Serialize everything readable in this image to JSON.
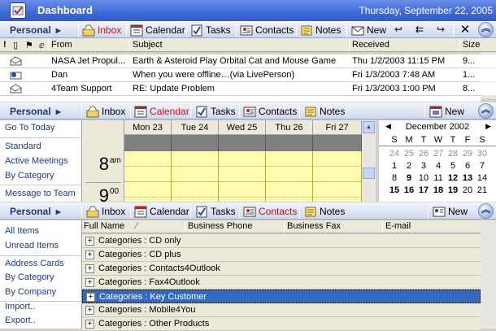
{
  "title_bar": {
    "title": "Dashboard",
    "date": "Thursday, September 22, 2005"
  },
  "inbox_toolbar": {
    "personal": "Personal",
    "buttons": [
      {
        "label": "Inbox",
        "icon": "inbox-icon",
        "active": true
      },
      {
        "label": "Calendar",
        "icon": "calendar-icon",
        "active": false
      },
      {
        "label": "Tasks",
        "icon": "tasks-icon",
        "active": false
      },
      {
        "label": "Contacts",
        "icon": "contacts-icon",
        "active": false
      },
      {
        "label": "Notes",
        "icon": "notes-icon",
        "active": false
      }
    ],
    "new_label": "New",
    "extra_icons": [
      "reply-icon",
      "reply-all-icon",
      "forward-icon",
      "delete-icon",
      "collapse-icon"
    ]
  },
  "inbox_columns": {
    "importance": "!",
    "from": "From",
    "subject": "Subject",
    "received": "Received",
    "size": "Size"
  },
  "inbox_rows": [
    {
      "from": "NASA Jet Propul...",
      "subject": "Earth & Asteroid Play Orbital Cat and Mouse Game",
      "received": "Thu 1/2/2003 11:15 PM",
      "size": "9..."
    },
    {
      "from": "Dan",
      "subject": "When you were offline…(via LivePerson)",
      "received": "Fri 1/3/2003 7:48 AM",
      "size": "1..."
    },
    {
      "from": "4Team Support",
      "subject": "RE: Update Problem",
      "received": "Fri 1/3/2003 1:00 PM",
      "size": "8..."
    }
  ],
  "calendar_toolbar": {
    "personal": "Personal",
    "buttons": [
      {
        "label": "Inbox",
        "active": false
      },
      {
        "label": "Calendar",
        "active": true
      },
      {
        "label": "Tasks",
        "active": false
      },
      {
        "label": "Contacts",
        "active": false
      },
      {
        "label": "Notes",
        "active": false
      }
    ],
    "new_label": "New"
  },
  "calendar_nav": [
    {
      "label": "Go To Today"
    },
    {
      "label": "Standard"
    },
    {
      "label": "Active Meetings"
    },
    {
      "label": "By Category"
    },
    {
      "label": "Message to Team"
    }
  ],
  "calendar_days": [
    "Mon 23",
    "Tue 24",
    "Wed 25",
    "Thu 26",
    "Fri 27"
  ],
  "calendar_times": [
    {
      "hour": "8",
      "suffix": "am"
    },
    {
      "hour": "9",
      "suffix": "00"
    }
  ],
  "mini_calendar": {
    "month": "December 2002",
    "dow": [
      "S",
      "M",
      "T",
      "W",
      "T",
      "F",
      "S"
    ],
    "weeks": [
      [
        {
          "d": "24",
          "g": 1
        },
        {
          "d": "25",
          "g": 1
        },
        {
          "d": "26",
          "g": 1
        },
        {
          "d": "27",
          "g": 1
        },
        {
          "d": "28",
          "g": 1
        },
        {
          "d": "29",
          "g": 1
        },
        {
          "d": "30",
          "g": 1
        }
      ],
      [
        {
          "d": "1"
        },
        {
          "d": "2"
        },
        {
          "d": "3"
        },
        {
          "d": "4"
        },
        {
          "d": "5"
        },
        {
          "d": "6"
        },
        {
          "d": "7"
        }
      ],
      [
        {
          "d": "8"
        },
        {
          "d": "9",
          "b": 1
        },
        {
          "d": "10"
        },
        {
          "d": "11"
        },
        {
          "d": "12",
          "b": 1
        },
        {
          "d": "13",
          "b": 1
        },
        {
          "d": "14"
        }
      ],
      [
        {
          "d": "15",
          "b": 1
        },
        {
          "d": "16",
          "b": 1
        },
        {
          "d": "17",
          "b": 1
        },
        {
          "d": "18",
          "b": 1
        },
        {
          "d": "19",
          "b": 1
        },
        {
          "d": "20"
        },
        {
          "d": "21"
        }
      ]
    ]
  },
  "contacts_toolbar": {
    "personal": "Personal",
    "buttons": [
      {
        "label": "Inbox",
        "active": false
      },
      {
        "label": "Calendar",
        "active": false
      },
      {
        "label": "Tasks",
        "active": false
      },
      {
        "label": "Contacts",
        "active": true
      },
      {
        "label": "Notes",
        "active": false
      }
    ],
    "new_label": "New"
  },
  "contacts_nav": [
    {
      "label": "All Items"
    },
    {
      "label": "Unread Items"
    },
    {
      "label": "Address Cards"
    },
    {
      "label": "By Category"
    },
    {
      "label": "By Company"
    },
    {
      "label": "Import.."
    },
    {
      "label": "Export.."
    }
  ],
  "contacts_columns": {
    "full_name": "Full Name",
    "business_phone": "Business Phone",
    "business_fax": "Business Fax",
    "email": "E-mail"
  },
  "contact_groups": [
    {
      "label": "Categories : CD only",
      "selected": false
    },
    {
      "label": "Categories : CD plus",
      "selected": false
    },
    {
      "label": "Categories : Contacts4Outlook",
      "selected": false
    },
    {
      "label": "Categories : Fax4Outlook",
      "selected": false
    },
    {
      "label": "Categories : Key Customer",
      "selected": true
    },
    {
      "label": "Categories : Mobile4You",
      "selected": false
    },
    {
      "label": "Categories : Other Products",
      "selected": false
    }
  ],
  "colors": {
    "titlebar": "#3d6ad7",
    "active_tab": "#d01010",
    "selection": "#316ac5",
    "calendar_workhours": "#fffcb0",
    "link": "#1c3a8a"
  }
}
